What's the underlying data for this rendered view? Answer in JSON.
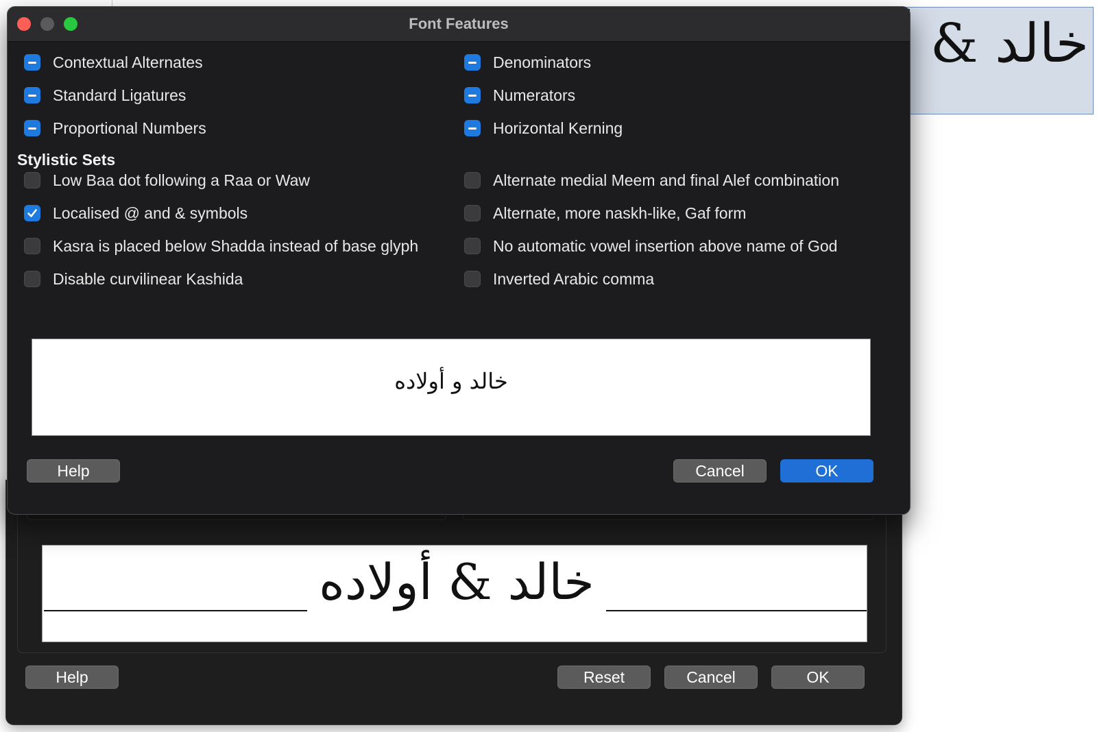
{
  "background_document": {
    "selected_text": "خالد & أ"
  },
  "parent_dialog": {
    "preview_text": "خالد & أولاده",
    "buttons": {
      "help": "Help",
      "reset": "Reset",
      "cancel": "Cancel",
      "ok": "OK"
    }
  },
  "font_features": {
    "title": "Font Features",
    "features_left": [
      {
        "label": "Contextual Alternates",
        "state": "mixed"
      },
      {
        "label": "Standard Ligatures",
        "state": "mixed"
      },
      {
        "label": "Proportional Numbers",
        "state": "mixed"
      }
    ],
    "features_right": [
      {
        "label": "Denominators",
        "state": "mixed"
      },
      {
        "label": "Numerators",
        "state": "mixed"
      },
      {
        "label": "Horizontal Kerning",
        "state": "mixed"
      }
    ],
    "stylistic_sets_title": "Stylistic Sets",
    "sets_left": [
      {
        "label": "Low Baa dot following a Raa or Waw",
        "state": "off"
      },
      {
        "label": "Localised @ and & symbols",
        "state": "on"
      },
      {
        "label": "Kasra is placed below Shadda instead of base glyph",
        "state": "off"
      },
      {
        "label": "Disable curvilinear Kashida",
        "state": "off"
      }
    ],
    "sets_right": [
      {
        "label": "Alternate medial Meem and final Alef combination",
        "state": "off"
      },
      {
        "label": "Alternate, more naskh-like, Gaf form",
        "state": "off"
      },
      {
        "label": "No automatic vowel insertion above name of God",
        "state": "off"
      },
      {
        "label": "Inverted Arabic comma",
        "state": "off"
      }
    ],
    "preview_text": "خالد ﻭ أولاده",
    "buttons": {
      "help": "Help",
      "cancel": "Cancel",
      "ok": "OK"
    }
  },
  "colors": {
    "accent": "#1f7ae0",
    "dialog_bg": "#1c1c1e"
  }
}
